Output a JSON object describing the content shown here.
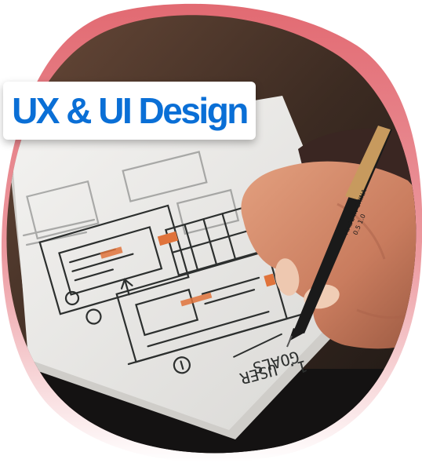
{
  "badge": {
    "title": "UX & UI Design",
    "text_color": "#0a6fd6"
  },
  "photo": {
    "blob_gradient_top": "#e26a72",
    "blob_gradient_bottom": "#ffffff",
    "paper_color": "#ebebe9",
    "sketch_ink_color": "#2c2f2e",
    "accent_color": "#e0733b",
    "pen_color": "#1a1a1a",
    "pen_label_color": "#c79a5e",
    "handwriting_1": "USER",
    "handwriting_2": "GOALS",
    "handwriting_3": "1.",
    "pen_print_1": "MADE IN CHINA",
    "pen_print_2": "0.5 1.0"
  }
}
